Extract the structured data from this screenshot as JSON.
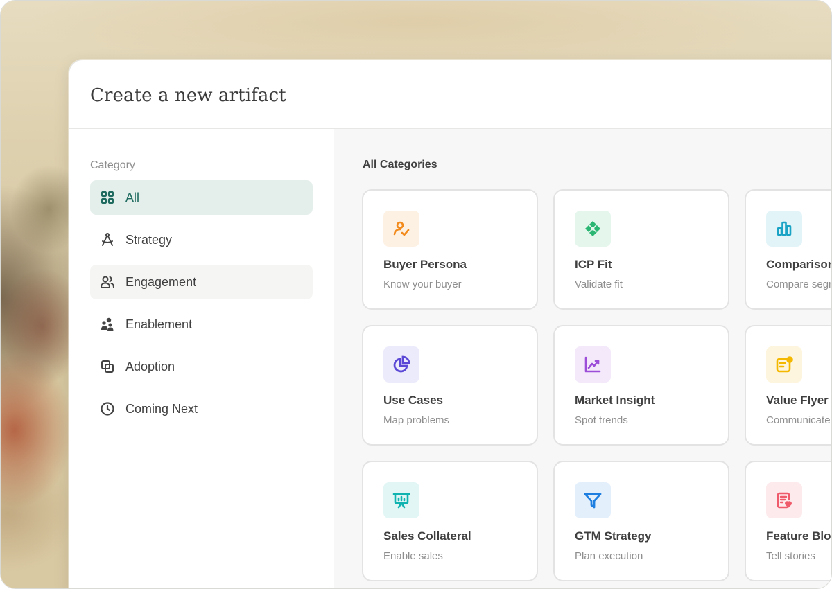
{
  "dialog": {
    "title": "Create a new artifact"
  },
  "sidebar": {
    "heading": "Category",
    "items": [
      {
        "label": "All",
        "icon": "grid-icon",
        "state": "selected"
      },
      {
        "label": "Strategy",
        "icon": "compass-icon"
      },
      {
        "label": "Engagement",
        "icon": "users-icon",
        "state": "hover"
      },
      {
        "label": "Enablement",
        "icon": "people-cluster-icon"
      },
      {
        "label": "Adoption",
        "icon": "copy-icon"
      },
      {
        "label": "Coming Next",
        "icon": "clock-icon"
      }
    ]
  },
  "main": {
    "heading": "All Categories",
    "cards": [
      {
        "title": "Buyer Persona",
        "desc": "Know your buyer",
        "icon": "persona-icon",
        "color": "#f28a1c",
        "tile": "#fdf1e4"
      },
      {
        "title": "ICP Fit",
        "desc": "Validate fit",
        "icon": "puzzle-icon",
        "color": "#2bb673",
        "tile": "#e5f6ec"
      },
      {
        "title": "Comparison",
        "desc": "Compare segments",
        "icon": "bar-chart-icon",
        "color": "#1aa3c4",
        "tile": "#e3f4f8"
      },
      {
        "title": "Use Cases",
        "desc": "Map problems",
        "icon": "pie-chart-icon",
        "color": "#5b48d6",
        "tile": "#ecebfb"
      },
      {
        "title": "Market Insight",
        "desc": "Spot trends",
        "icon": "trend-chart-icon",
        "color": "#9c4ed8",
        "tile": "#f3e9fb"
      },
      {
        "title": "Value Flyer",
        "desc": "Communicate value",
        "icon": "flyer-icon",
        "color": "#f5b800",
        "tile": "#fdf5dd"
      },
      {
        "title": "Sales Collateral",
        "desc": "Enable sales",
        "icon": "presentation-icon",
        "color": "#11b3b0",
        "tile": "#e1f6f5"
      },
      {
        "title": "GTM Strategy",
        "desc": "Plan execution",
        "icon": "funnel-icon",
        "color": "#1e7fe0",
        "tile": "#e3effb"
      },
      {
        "title": "Feature Blog",
        "desc": "Tell stories",
        "icon": "blog-icon",
        "color": "#ef5b6b",
        "tile": "#fdeaec"
      }
    ]
  }
}
